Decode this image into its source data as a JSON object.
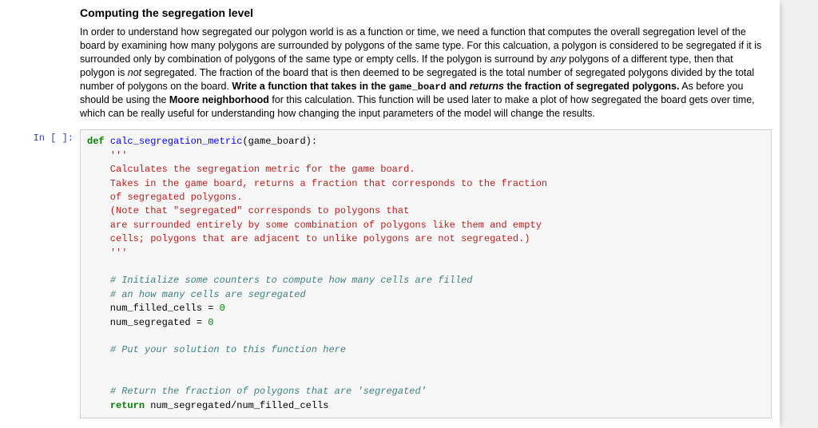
{
  "text": {
    "heading": "Computing the segregation level",
    "p_parts": [
      {
        "t": "In order to understand how segregated our polygon world is as a function or time, we need a function that computes the overall segregation level of the board by examining how many polygons are surrounded by polygons of the same type. For this calcuation, a polygon is considered to be segregated if it is surrounded only by combination of polygons of the same type or empty cells. If the polygon is surround by "
      },
      {
        "t": "any",
        "i": true
      },
      {
        "t": " polygons of a different type, then that polygon is "
      },
      {
        "t": "not",
        "i": true
      },
      {
        "t": " segregated. The fraction of the board that is then deemed to be segregated is the total number of segregated polygons divided by the total number of polygons on the board. "
      },
      {
        "t": "Write a function that takes in the ",
        "b": true
      },
      {
        "t": "game_board",
        "b": true,
        "mono": true
      },
      {
        "t": " and ",
        "b": true
      },
      {
        "t": "returns",
        "b": true,
        "i": true
      },
      {
        "t": " the fraction of segregated polygons.",
        "b": true
      },
      {
        "t": " As before you should be using the "
      },
      {
        "t": "Moore neighborhood",
        "b": true
      },
      {
        "t": " for this calculation. This function will be used later to make a plot of how segregated the board gets over time, which can be really useful for understanding how changing the input parameters of the model will change the results."
      }
    ]
  },
  "code": {
    "prompt": "In [ ]:",
    "tokens": [
      {
        "t": "def ",
        "c": "tok-kw"
      },
      {
        "t": "calc_segregation_metric",
        "c": "tok-def"
      },
      {
        "t": "(game_board):"
      },
      {
        "nl": 1
      },
      {
        "t": "    "
      },
      {
        "t": "'''",
        "c": "tok-str"
      },
      {
        "nl": 1
      },
      {
        "t": "    Calculates the segregation metric for the game board.",
        "c": "tok-str"
      },
      {
        "nl": 1
      },
      {
        "t": "    Takes in the game board, returns a fraction that corresponds to the fraction",
        "c": "tok-str"
      },
      {
        "nl": 1
      },
      {
        "t": "    of segregated polygons.",
        "c": "tok-str"
      },
      {
        "nl": 1
      },
      {
        "t": "    (Note that \"segregated\" corresponds to polygons that",
        "c": "tok-str"
      },
      {
        "nl": 1
      },
      {
        "t": "    are surrounded entirely by some combination of polygons like them and empty",
        "c": "tok-str"
      },
      {
        "nl": 1
      },
      {
        "t": "    cells; polygons that are adjacent to unlike polygons are not segregated.)",
        "c": "tok-str"
      },
      {
        "nl": 1
      },
      {
        "t": "    "
      },
      {
        "t": "'''",
        "c": "tok-str"
      },
      {
        "nl": 1
      },
      {
        "nl": 1
      },
      {
        "t": "    "
      },
      {
        "t": "# Initialize some counters to compute how many cells are filled",
        "c": "tok-com"
      },
      {
        "nl": 1
      },
      {
        "t": "    "
      },
      {
        "t": "# an how many cells are segregated",
        "c": "tok-com"
      },
      {
        "nl": 1
      },
      {
        "t": "    num_filled_cells = "
      },
      {
        "t": "0",
        "c": "tok-num"
      },
      {
        "nl": 1
      },
      {
        "t": "    num_segregated = "
      },
      {
        "t": "0",
        "c": "tok-num"
      },
      {
        "nl": 1
      },
      {
        "nl": 1
      },
      {
        "t": "    "
      },
      {
        "t": "# Put your solution to this function here",
        "c": "tok-com"
      },
      {
        "nl": 1
      },
      {
        "nl": 1
      },
      {
        "nl": 1
      },
      {
        "t": "    "
      },
      {
        "t": "# Return the fraction of polygons that are 'segregated'",
        "c": "tok-com"
      },
      {
        "nl": 1
      },
      {
        "t": "    "
      },
      {
        "t": "return",
        "c": "tok-kw"
      },
      {
        "t": " num_segregated/num_filled_cells"
      }
    ]
  }
}
